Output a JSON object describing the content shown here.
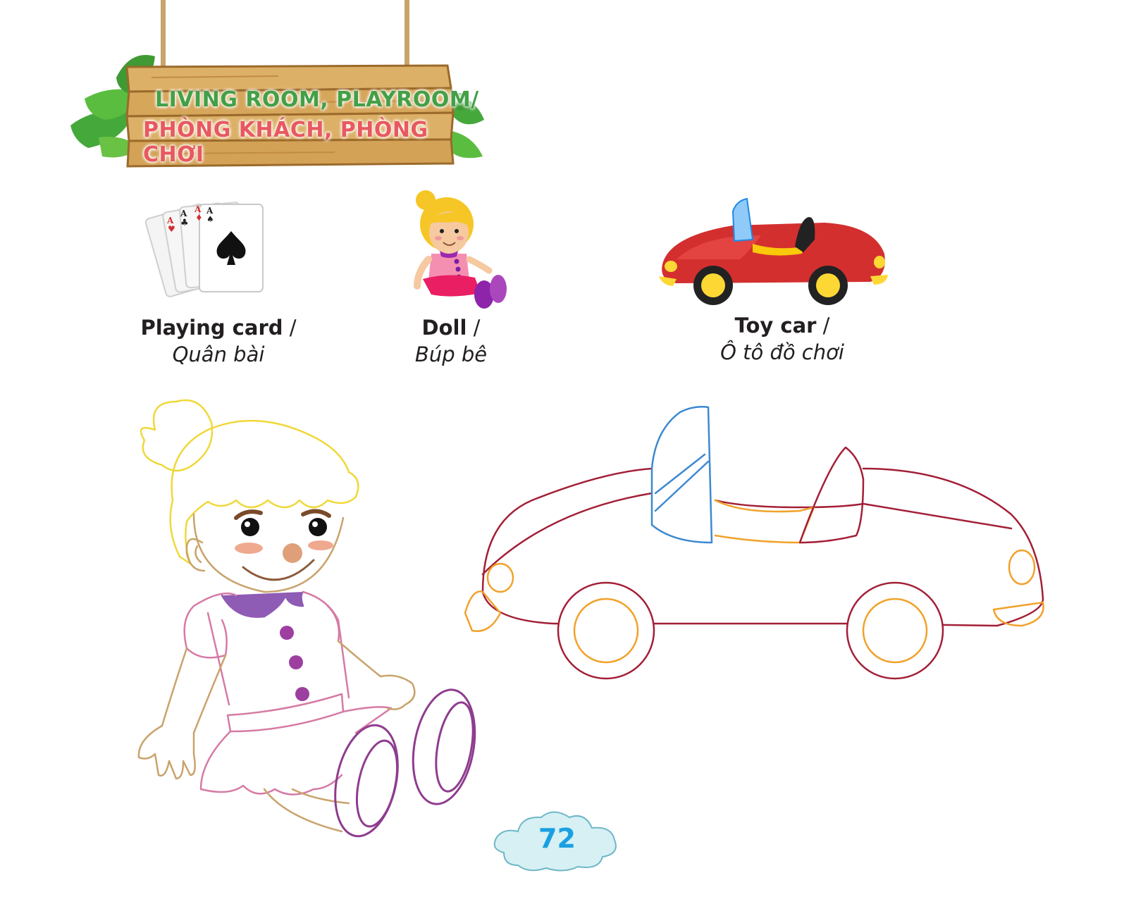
{
  "sign": {
    "line1": "LIVING ROOM, PLAYROOM/",
    "line2": "PHÒNG KHÁCH, PHÒNG CHƠI"
  },
  "words": [
    {
      "en": "Playing card",
      "slash": " /",
      "vi": "Quân bài",
      "icon": "playing-cards-icon"
    },
    {
      "en": "Doll",
      "slash": " /",
      "vi": "Búp bê",
      "icon": "doll-icon"
    },
    {
      "en": "Toy car",
      "slash": " /",
      "vi": "Ô tô đồ chơi",
      "icon": "toy-car-icon"
    }
  ],
  "cards": {
    "rank": "A",
    "suit_spade": "♠",
    "suit_club": "♣",
    "suit_heart": "♥",
    "suit_diamond": "♦"
  },
  "page_number": "72",
  "colors": {
    "sign_line1": "#43a047",
    "sign_line2": "#e8595f",
    "wood": "#d9ac62",
    "leaf": "#3aa03a",
    "page_number": "#1aa0e0",
    "cloud": "#d6f0f4"
  }
}
